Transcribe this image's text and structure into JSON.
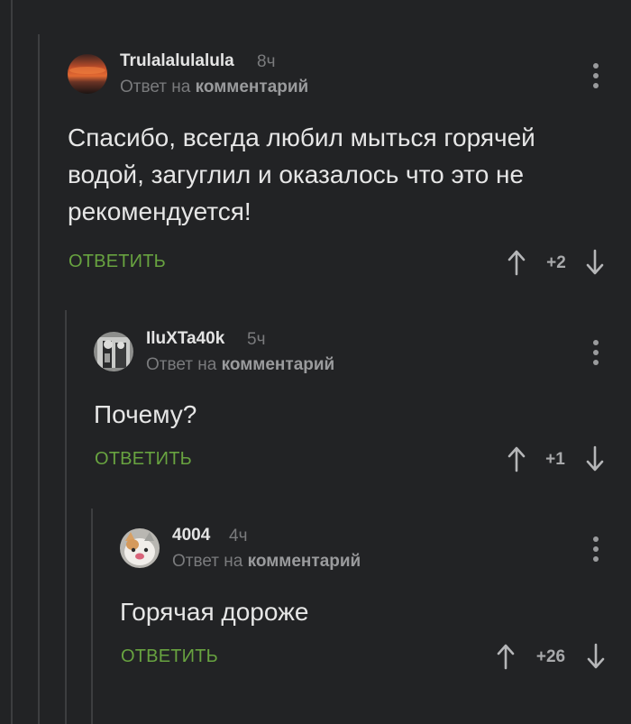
{
  "comments": [
    {
      "author": "Trulalalulalula",
      "time": "8ч",
      "reply_prefix": "Ответ на",
      "reply_target": "комментарий",
      "text": "Спасибо, всегда любил мыться горячей водой, загуглил и оказалось что это не рекомендуется!",
      "reply_label": "ОТВЕТИТЬ",
      "score": "+2"
    },
    {
      "author": "IluXTa40k",
      "time": "5ч",
      "reply_prefix": "Ответ на",
      "reply_target": "комментарий",
      "text": "Почему?",
      "reply_label": "ОТВЕТИТЬ",
      "score": "+1"
    },
    {
      "author": "4004",
      "time": "4ч",
      "reply_prefix": "Ответ на",
      "reply_target": "комментарий",
      "text": "Горячая дороже",
      "reply_label": "ОТВЕТИТЬ",
      "score": "+26"
    }
  ],
  "colors": {
    "background": "#222325",
    "reply_action": "#68a340",
    "muted_text": "#7a7b7d"
  },
  "icons": [
    "more-vertical-icon",
    "arrow-up-icon",
    "arrow-down-icon"
  ]
}
